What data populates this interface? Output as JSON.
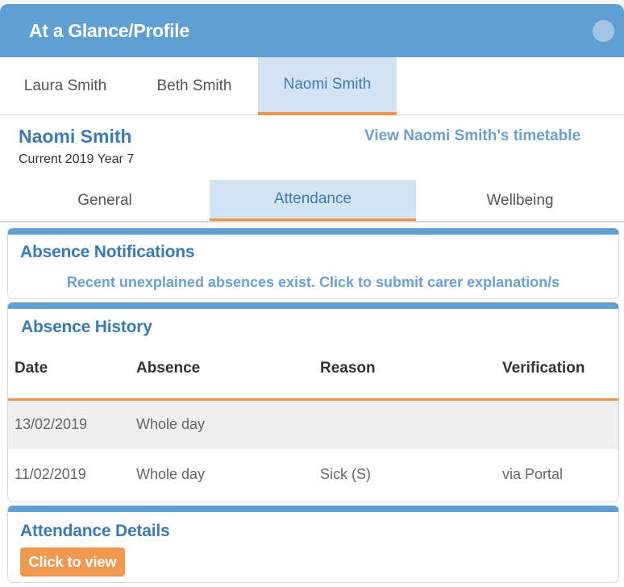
{
  "header": {
    "title": "At a Glance/Profile",
    "menu_icon": "circle-dot-icon"
  },
  "student_tabs": [
    {
      "label": "Laura Smith",
      "active": false
    },
    {
      "label": "Beth Smith",
      "active": false
    },
    {
      "label": "Naomi Smith",
      "active": true
    }
  ],
  "profile": {
    "name": "Naomi Smith",
    "subtitle": "Current 2019 Year 7",
    "timetable_link": "View Naomi Smith's timetable"
  },
  "view_tabs": [
    {
      "label": "General",
      "active": false
    },
    {
      "label": "Attendance",
      "active": true
    },
    {
      "label": "Wellbeing",
      "active": false
    }
  ],
  "absence_notifications": {
    "title": "Absence Notifications",
    "message": "Recent unexplained absences exist. Click to submit carer explanation/s"
  },
  "absence_history": {
    "title": "Absence History",
    "columns": [
      "Date",
      "Absence",
      "Reason",
      "Verification"
    ],
    "rows": [
      {
        "date": "13/02/2019",
        "absence": "Whole day",
        "reason": "",
        "verification": ""
      },
      {
        "date": "11/02/2019",
        "absence": "Whole day",
        "reason": "Sick (S)",
        "verification": "via Portal"
      }
    ]
  },
  "attendance_details": {
    "title": "Attendance Details",
    "button_label": "Click to view"
  },
  "colors": {
    "primary": "#5f9fd2",
    "accent": "#f0924a",
    "link": "#6aa0d4",
    "title": "#3a7ab9",
    "active_tab_bg": "#d4e4f2"
  }
}
